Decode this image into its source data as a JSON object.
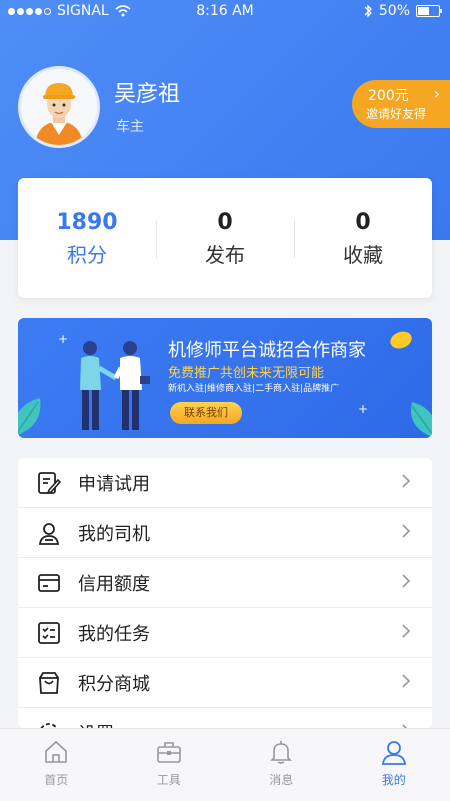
{
  "status_bar": {
    "carrier": "SIGNAL",
    "time": "8:16 AM",
    "battery": "50%"
  },
  "user": {
    "name": "吴彦祖",
    "role": "车主"
  },
  "invite": {
    "amount": "200元",
    "desc": "邀请好友得"
  },
  "stats": [
    {
      "value": "1890",
      "label": "积分"
    },
    {
      "value": "0",
      "label": "发布"
    },
    {
      "value": "0",
      "label": "收藏"
    }
  ],
  "banner": {
    "title": "机修师平台诚招合作商家",
    "subtitle": "免费推广共创未来无限可能",
    "tags": "新机入驻|维修商入驻|二手商入驻|品牌推广",
    "button": "联系我们"
  },
  "menu": [
    {
      "label": "申请试用",
      "icon": "edit-icon"
    },
    {
      "label": "我的司机",
      "icon": "driver-icon"
    },
    {
      "label": "信用额度",
      "icon": "card-icon"
    },
    {
      "label": "我的任务",
      "icon": "tasks-icon"
    },
    {
      "label": "积分商城",
      "icon": "shopping-bag-icon"
    },
    {
      "label": "设置",
      "icon": "gear-icon"
    }
  ],
  "tabs": [
    {
      "label": "首页",
      "icon": "home-icon"
    },
    {
      "label": "工具",
      "icon": "toolbox-icon"
    },
    {
      "label": "消息",
      "icon": "bell-icon"
    },
    {
      "label": "我的",
      "icon": "user-icon"
    }
  ],
  "colors": {
    "primary": "#3a78ee",
    "accent": "#f5a623"
  }
}
